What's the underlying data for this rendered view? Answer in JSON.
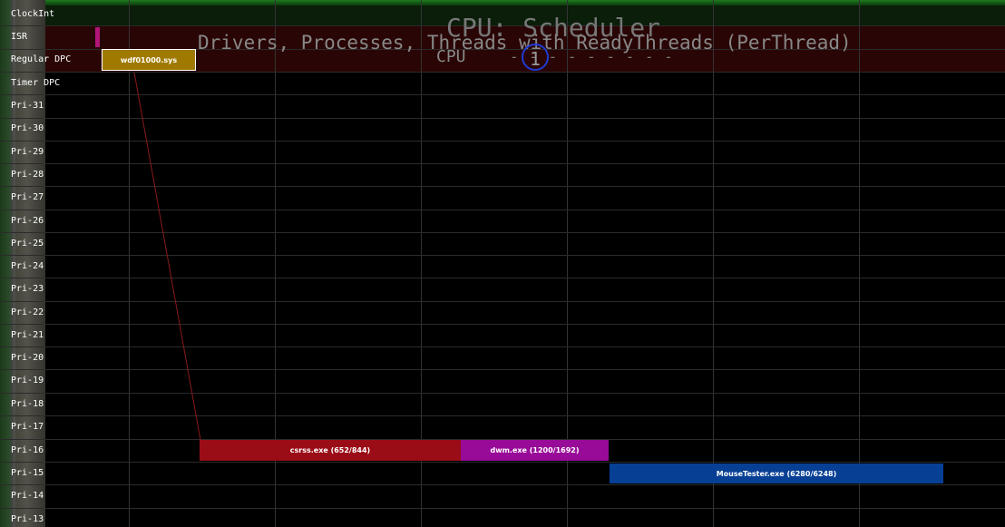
{
  "title": "CPU: Scheduler",
  "subtitle": "Drivers, Processes, Threads with ReadyThreads (PerThread)",
  "cpu_label": "CPU",
  "cpu_number": "1",
  "cpu_dashes": "- - - - - - - - -",
  "rows": [
    "ClockInt",
    "ISR",
    "Regular DPC",
    "Timer DPC",
    "Pri-31",
    "Pri-30",
    "Pri-29",
    "Pri-28",
    "Pri-27",
    "Pri-26",
    "Pri-25",
    "Pri-24",
    "Pri-23",
    "Pri-22",
    "Pri-21",
    "Pri-20",
    "Pri-19",
    "Pri-18",
    "Pri-17",
    "Pri-16",
    "Pri-15",
    "Pri-14",
    "Pri-13"
  ],
  "bars": {
    "driver": {
      "label": "wdf01000.sys",
      "color": "#a07a00"
    },
    "csrss": {
      "label": "csrss.exe (652/844)",
      "color": "#9a0d17"
    },
    "dwm": {
      "label": "dwm.exe (1200/1692)",
      "color": "#980b98"
    },
    "mousetester": {
      "label": "MouseTester.exe (6280/6248)",
      "color": "#073f94"
    }
  },
  "colors": {
    "isr_marker": "#b0157a",
    "cpu_circle": "#1f3bd4",
    "connector": "#8a1a1a"
  }
}
